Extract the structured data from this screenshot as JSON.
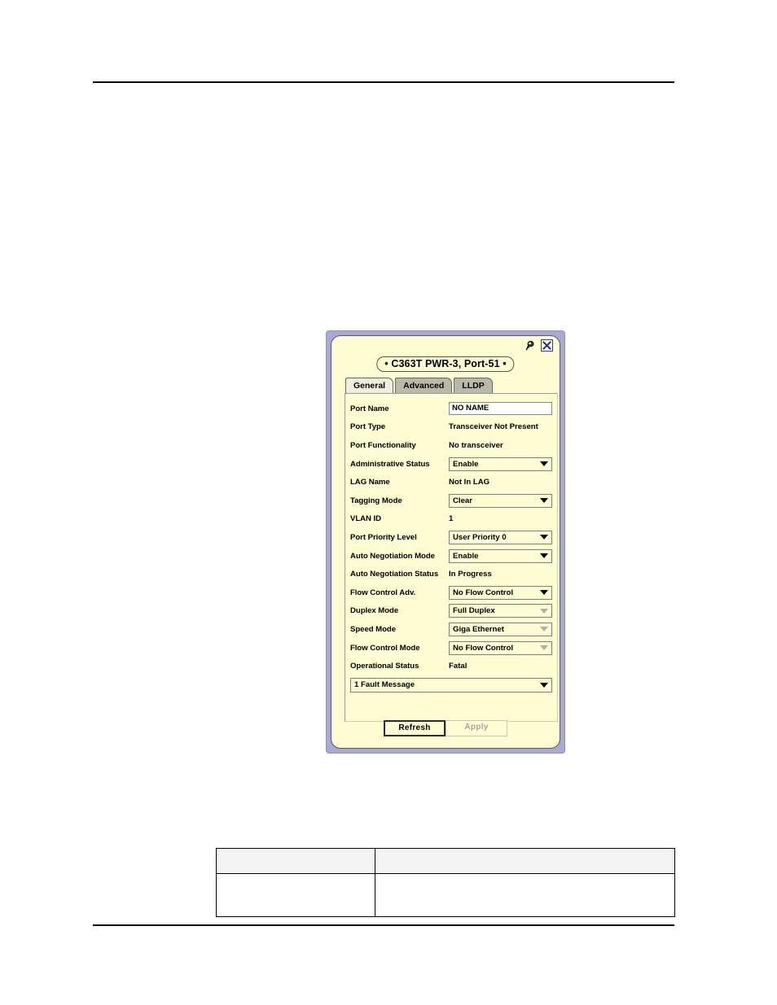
{
  "document": {
    "header_rule": true,
    "footer_rule": true
  },
  "dialog": {
    "title": "• C363T PWR-3, Port-51 •",
    "icons": {
      "pin": "pin-icon",
      "close": "close-icon"
    },
    "tabs": [
      {
        "label": "General",
        "selected": true
      },
      {
        "label": "Advanced",
        "selected": false
      },
      {
        "label": "LLDP",
        "selected": false
      }
    ],
    "fields": [
      {
        "label": "Port Name",
        "type": "text",
        "value": "NO NAME",
        "disabled": false,
        "name": "port-name"
      },
      {
        "label": "Port Type",
        "type": "static",
        "value": "Transceiver Not Present",
        "disabled": false,
        "name": "port-type"
      },
      {
        "label": "Port Functionality",
        "type": "static",
        "value": "No transceiver",
        "disabled": false,
        "name": "port-functionality"
      },
      {
        "label": "Administrative Status",
        "type": "dropdown",
        "value": "Enable",
        "disabled": false,
        "name": "administrative-status"
      },
      {
        "label": "LAG Name",
        "type": "static",
        "value": "Not In LAG",
        "disabled": false,
        "name": "lag-name"
      },
      {
        "label": "Tagging Mode",
        "type": "dropdown",
        "value": "Clear",
        "disabled": false,
        "name": "tagging-mode"
      },
      {
        "label": "VLAN ID",
        "type": "static",
        "value": "1",
        "disabled": false,
        "name": "vlan-id"
      },
      {
        "label": "Port Priority Level",
        "type": "dropdown",
        "value": "User Priority 0",
        "disabled": false,
        "name": "port-priority-level"
      },
      {
        "label": "Auto Negotiation Mode",
        "type": "dropdown",
        "value": "Enable",
        "disabled": false,
        "name": "auto-negotiation-mode"
      },
      {
        "label": "Auto Negotiation Status",
        "type": "static",
        "value": "In Progress",
        "disabled": false,
        "name": "auto-negotiation-status"
      },
      {
        "label": "Flow Control Adv.",
        "type": "dropdown",
        "value": "No Flow Control",
        "disabled": false,
        "name": "flow-control-adv"
      },
      {
        "label": "Duplex Mode",
        "type": "dropdown",
        "value": "Full Duplex",
        "disabled": true,
        "name": "duplex-mode"
      },
      {
        "label": "Speed Mode",
        "type": "dropdown",
        "value": "Giga Ethernet",
        "disabled": true,
        "name": "speed-mode"
      },
      {
        "label": "Flow Control Mode",
        "type": "dropdown",
        "value": "No Flow Control",
        "disabled": true,
        "name": "flow-control-mode"
      },
      {
        "label": "Operational Status",
        "type": "static",
        "value": "Fatal",
        "disabled": false,
        "name": "operational-status"
      }
    ],
    "fault_message": {
      "value": "1 Fault Message",
      "disabled": false
    },
    "buttons": [
      {
        "label": "Refresh",
        "disabled": false,
        "primary": true,
        "name": "refresh-button"
      },
      {
        "label": "Apply",
        "disabled": true,
        "primary": false,
        "name": "apply-button"
      }
    ]
  },
  "table": {
    "headers": [
      "",
      ""
    ],
    "rows": [
      [
        "",
        ""
      ]
    ]
  },
  "colors": {
    "dialog_frame": "#a9a9d4",
    "dialog_body": "#fdfcd2",
    "tab_selected": "#eeeedd",
    "tab_unselected": "#b9b9a8",
    "close_icon": "#2a2aa8",
    "disabled_text": "#a8a89a"
  }
}
